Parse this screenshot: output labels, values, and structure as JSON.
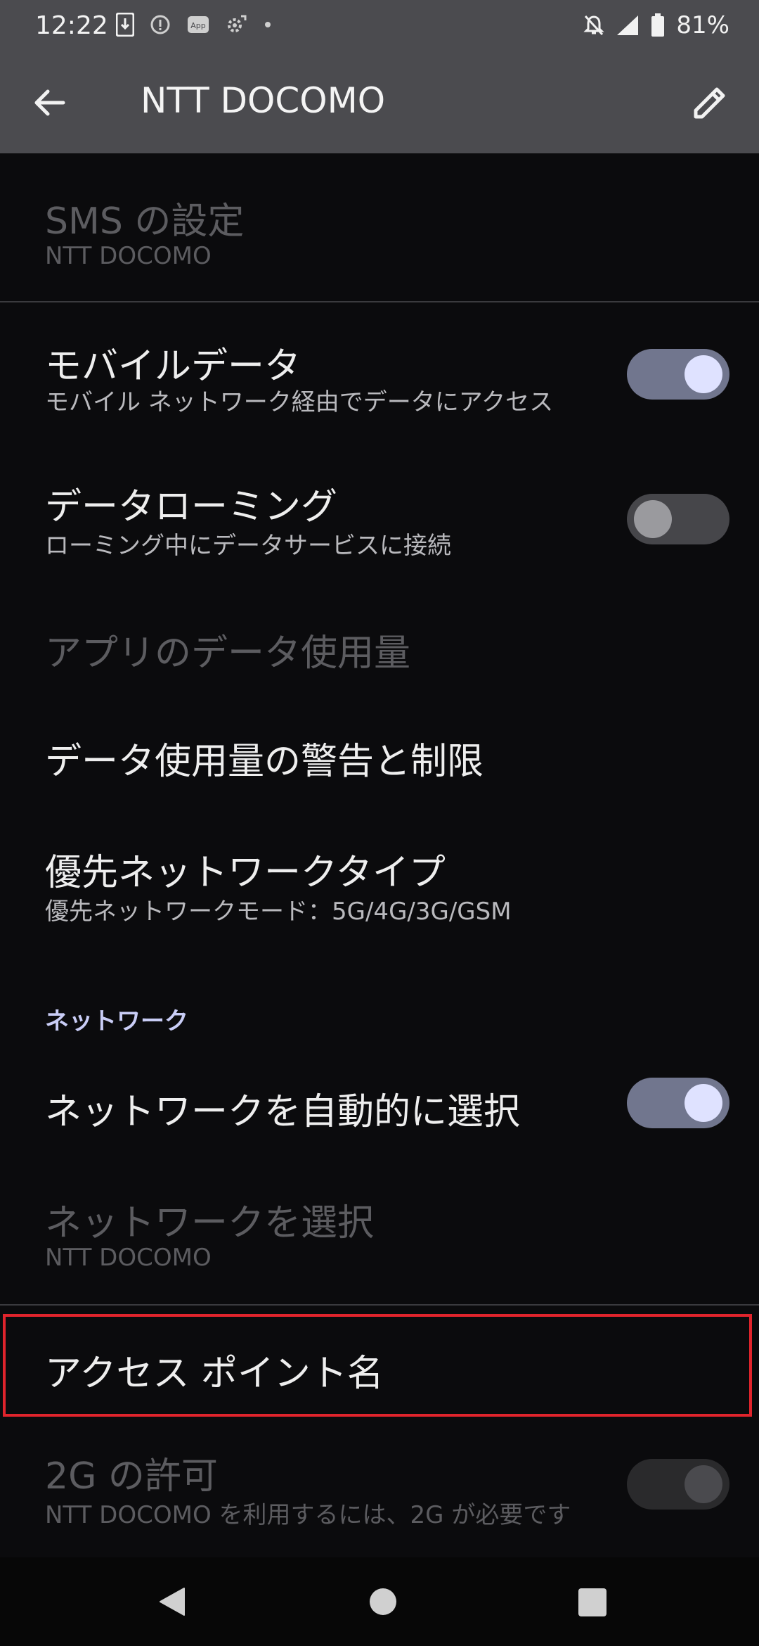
{
  "status_bar": {
    "time": "12:22",
    "battery_percent": "81%",
    "left_icons": [
      "download-icon",
      "info-circle-icon",
      "app-icon",
      "settings-sync-icon",
      "dot-icon"
    ],
    "right_icons": [
      "notifications-off-icon",
      "signal-icon",
      "battery-icon"
    ]
  },
  "app_bar": {
    "title": "NTT DOCOMO"
  },
  "settings": {
    "sms": {
      "title": "SMS の設定",
      "subtitle": "NTT DOCOMO",
      "enabled": false
    },
    "mobile_data": {
      "title": "モバイルデータ",
      "subtitle": "モバイル ネットワーク経由でデータにアクセス",
      "toggle": true
    },
    "roaming": {
      "title": "データローミング",
      "subtitle": "ローミング中にデータサービスに接続",
      "toggle": false
    },
    "app_data_usage": {
      "title": "アプリのデータ使用量",
      "enabled": false
    },
    "data_warning": {
      "title": "データ使用量の警告と制限"
    },
    "preferred_network": {
      "title": "優先ネットワークタイプ",
      "subtitle": "優先ネットワークモード：5G/4G/3G/GSM"
    },
    "network_section_header": "ネットワーク",
    "auto_select": {
      "title": "ネットワークを自動的に選択",
      "toggle": true
    },
    "select_network": {
      "title": "ネットワークを選択",
      "subtitle": "NTT DOCOMO",
      "enabled": false
    },
    "apn": {
      "title": "アクセス ポイント名"
    },
    "allow_2g": {
      "title": "2G の許可",
      "subtitle": "NTT DOCOMO を利用するには、2G が必要です",
      "toggle": true,
      "enabled": false
    }
  },
  "colors": {
    "highlight_border": "#e0242c",
    "toggle_on_track": "#71768e",
    "toggle_on_knob": "#dfe2ff",
    "section_header": "#c9cdf6"
  }
}
